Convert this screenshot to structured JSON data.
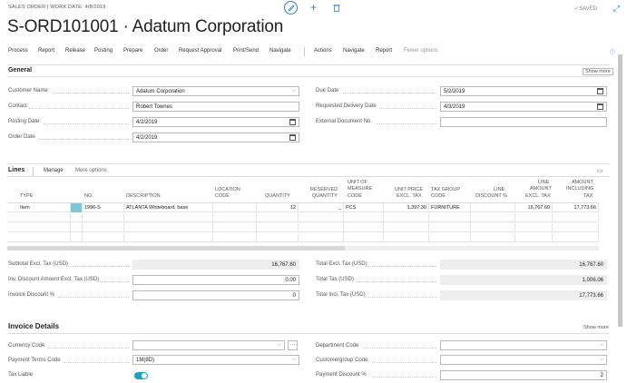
{
  "header": {
    "breadcrumb": "SALES ORDER | WORK DATE: 4/8/2019",
    "title": "S-ORD101001 · Adatum Corporation",
    "status": "✓SAVED",
    "edit_icon": "pencil-icon",
    "add_icon": "plus-icon",
    "delete_icon": "trash-icon",
    "expand_icon": "expand-icon"
  },
  "actions": [
    "Process",
    "Report",
    "Release",
    "Posting",
    "Prepare",
    "Order",
    "Request Approval",
    "Print/Send",
    "Navigate",
    "Actions",
    "Navigate",
    "Report",
    "Fewer options"
  ],
  "general": {
    "title": "General",
    "show_more": "Show more",
    "customer_name_label": "Customer Name",
    "customer_name": "Adatum Corporation",
    "contact_label": "Contact",
    "contact": "Robert Townes",
    "posting_date_label": "Posting Date",
    "posting_date": "4/2/2019",
    "order_date_label": "Order Date",
    "order_date": "4/2/2019",
    "due_date_label": "Due Date",
    "due_date": "5/2/2019",
    "requested_delivery_label": "Requested Delivery Date",
    "requested_delivery": "4/3/2019",
    "external_doc_label": "External Document No.",
    "external_doc": ""
  },
  "lines": {
    "title": "Lines",
    "manage": "Manage",
    "more_options": "More options",
    "columns": {
      "type": "TYPE",
      "no": "NO.",
      "description": "DESCRIPTION",
      "location_1": "LOCATION",
      "location_2": "CODE",
      "quantity": "QUANTITY",
      "reserved_1": "RESERVED",
      "reserved_2": "QUANTITY",
      "uom_1": "UNIT OF",
      "uom_2": "MEASURE",
      "uom_3": "CODE",
      "unit_price_1": "UNIT PRICE",
      "unit_price_2": "EXCL. TAX",
      "tax_group_1": "TAX GROUP",
      "tax_group_2": "CODE",
      "line_disc_1": "LINE",
      "line_disc_2": "DISCOUNT %",
      "line_amount_1": "LINE",
      "line_amount_2": "AMOUNT",
      "line_amount_3": "EXCL. TAX",
      "amount_incl_1": "AMOUNT",
      "amount_incl_2": "INCLUDING",
      "amount_incl_3": "TAX"
    },
    "row": {
      "type": "Item",
      "no": "1996-S",
      "description": "ATLANTA Whiteboard, base",
      "location": "",
      "quantity": "12",
      "reserved": "_",
      "uom": "PCS",
      "unit_price": "1,397.30",
      "tax_group": "FURNITURE",
      "line_discount": "",
      "line_amount": "16,767.60",
      "amount_incl": "17,773.66"
    }
  },
  "totals": {
    "subtotal_label": "Subtotal Excl. Tax (USD)",
    "subtotal": "16,767.60",
    "inv_disc_amount_label": "Inv. Discount Amount Excl. Tax (USD)",
    "inv_disc_amount": "0.00",
    "inv_disc_pct_label": "Invoice Discount %",
    "inv_disc_pct": "0",
    "total_excl_label": "Total Excl. Tax (USD)",
    "total_excl": "16,767.60",
    "total_tax_label": "Total Tax (USD)",
    "total_tax": "1,006.06",
    "total_incl_label": "Total Incl. Tax (USD)",
    "total_incl": "17,773.66"
  },
  "invoice": {
    "title": "Invoice Details",
    "show_more": "Show more",
    "currency_label": "Currency Code",
    "currency": "",
    "payment_terms_label": "Payment Terms Code",
    "payment_terms": "1M(8D)",
    "tax_liable_label": "Tax Liable",
    "tax_liable": true,
    "department_label": "Department Code",
    "department": "",
    "customergroup_label": "Customergroup Code",
    "customergroup": "",
    "payment_discount_label": "Payment Discount %",
    "payment_discount": "2"
  },
  "colors": {
    "accent": "#2f7fc1",
    "toggle": "#1aa3c2"
  }
}
